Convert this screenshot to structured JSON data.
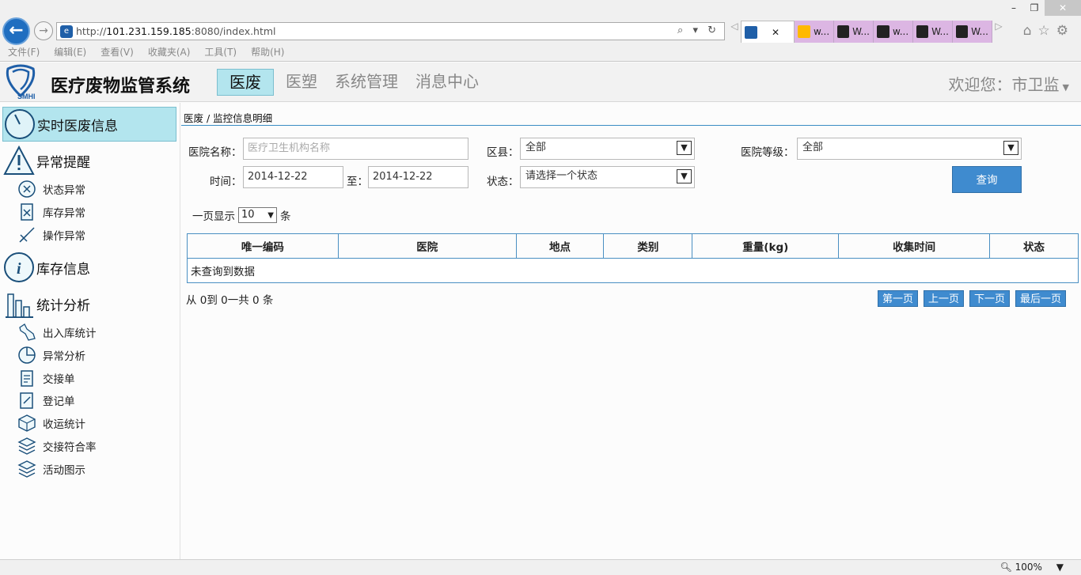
{
  "browser": {
    "url_prefix": "http://",
    "url_host": "101.231.159.185",
    "url_rest": ":8080/index.html",
    "addr_tools": "⌕ ▾ ↻",
    "tabs": [
      {
        "label": "",
        "kind": "ie",
        "active": true
      },
      {
        "label": "w...",
        "kind": "bing"
      },
      {
        "label": "W...",
        "kind": "dark"
      },
      {
        "label": "w...",
        "kind": "dark"
      },
      {
        "label": "W...",
        "kind": "dark"
      },
      {
        "label": "W...",
        "kind": "dark"
      }
    ],
    "menu": [
      "文件(F)",
      "编辑(E)",
      "查看(V)",
      "收藏夹(A)",
      "工具(T)",
      "帮助(H)"
    ],
    "zoom": "100%",
    "win_min": "–",
    "win_max": "❐",
    "win_close": "✕"
  },
  "header": {
    "logo_text": "SMHI",
    "title": "医疗废物监管系统",
    "nav": [
      "医废",
      "医塑",
      "系统管理",
      "消息中心"
    ],
    "welcome": "欢迎您：市卫监"
  },
  "sidebar": {
    "realtime": "实时医废信息",
    "alerts": "异常提醒",
    "alert_items": [
      "状态异常",
      "库存异常",
      "操作异常"
    ],
    "inventory": "库存信息",
    "stats": "统计分析",
    "stats_items": [
      "出入库统计",
      "异常分析",
      "交接单",
      "登记单",
      "收运统计",
      "交接符合率",
      "活动图示"
    ]
  },
  "content": {
    "breadcrumb": "医废 / 监控信息明细",
    "filters": {
      "hospital_label": "医院名称：",
      "hospital_placeholder": "医疗卫生机构名称",
      "district_label": "区县：",
      "district_value": "全部",
      "level_label": "医院等级：",
      "level_value": "全部",
      "time_label": "时间：",
      "time_from": "2014-12-22",
      "to_label": "至：",
      "time_to": "2014-12-22",
      "status_label": "状态：",
      "status_value": "请选择一个状态",
      "query_button": "查询"
    },
    "page_size": {
      "prefix": "一页显示",
      "value": "10",
      "suffix": "条"
    },
    "table": {
      "columns": [
        "唯一编码",
        "医院",
        "地点",
        "类别",
        "重量(kg)",
        "收集时间",
        "状态"
      ],
      "empty": "未查询到数据"
    },
    "summary": "从 0到 0一共 0 条",
    "pager": [
      "第一页",
      "上一页",
      "下一页",
      "最后一页"
    ]
  }
}
